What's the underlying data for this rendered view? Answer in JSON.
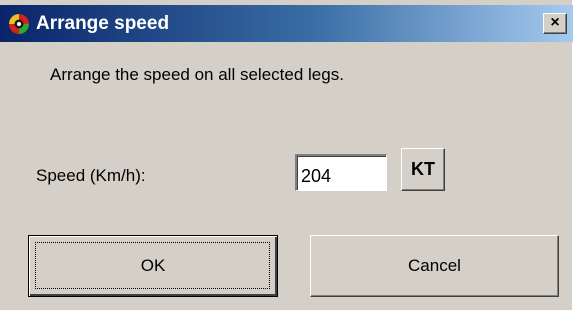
{
  "window": {
    "title": "Arrange speed",
    "close_glyph": "×",
    "app_icon": "app-logo-icon",
    "colors": {
      "titlebar_start": "#0a246a",
      "titlebar_end": "#a6caf0",
      "face": "#d4d0c8"
    }
  },
  "body": {
    "instruction": "Arrange the speed on  all selected legs.",
    "speed_label": "Speed (Km/h):",
    "speed_value": "204",
    "unit_toggle_label": "KT"
  },
  "buttons": {
    "ok_label": "OK",
    "cancel_label": "Cancel"
  }
}
